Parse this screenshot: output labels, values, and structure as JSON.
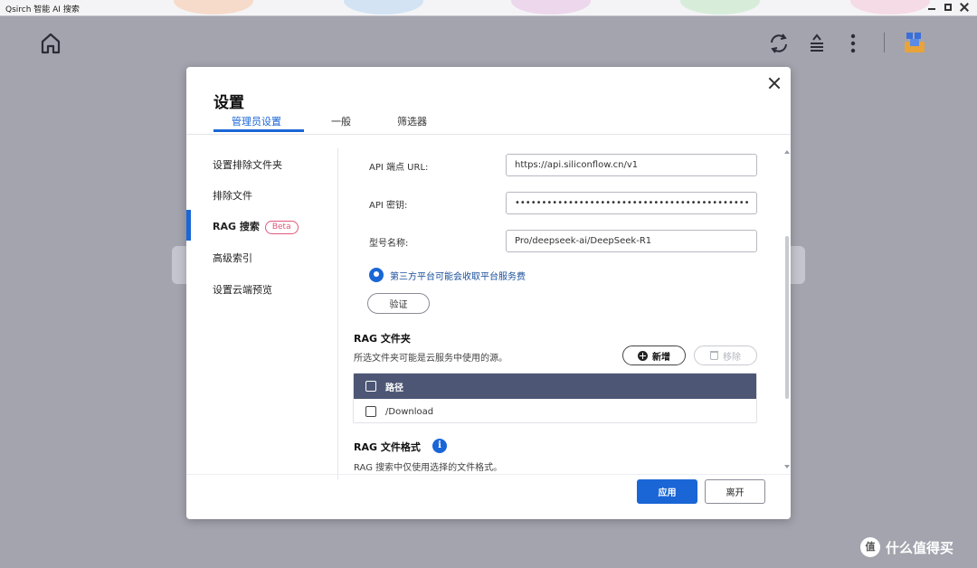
{
  "window": {
    "title": "Qsirch 智能 AI 搜索"
  },
  "modal": {
    "title": "设置",
    "tabs": [
      {
        "label": "管理员设置",
        "active": true
      },
      {
        "label": "一般",
        "active": false
      },
      {
        "label": "筛选器",
        "active": false
      }
    ],
    "sidebar": [
      {
        "label": "设置排除文件夹"
      },
      {
        "label": "排除文件"
      },
      {
        "label": "RAG 搜索",
        "badge": "Beta",
        "active": true
      },
      {
        "label": "高级索引"
      },
      {
        "label": "设置云端预览"
      }
    ],
    "fields": {
      "endpoint_label": "API 端点 URL:",
      "endpoint_value": "https://api.siliconflow.cn/v1",
      "key_label": "API 密钥:",
      "key_value": "••••••••••••••••••••••••••••••••••••••••••••••••••••••",
      "model_label": "型号名称:",
      "model_value": "Pro/deepseek-ai/DeepSeek-R1"
    },
    "notice": "第三方平台可能会收取平台服务费",
    "verify_label": "验证",
    "rag_folder": {
      "title": "RAG 文件夹",
      "desc": "所选文件夹可能是云服务中使用的源。",
      "add_label": "新增",
      "remove_label": "移除",
      "table_header": "路径",
      "rows": [
        "/Download"
      ]
    },
    "rag_format": {
      "title": "RAG 文件格式",
      "info_icon": "i",
      "desc": "RAG 搜索中仅使用选择的文件格式。"
    },
    "apply_label": "应用",
    "leave_label": "离开"
  },
  "watermark": {
    "badge": "值",
    "text": "什么值得买"
  },
  "colors": {
    "accent": "#1a66d6",
    "table_header": "#4d5775",
    "beta": "#e0577a"
  }
}
